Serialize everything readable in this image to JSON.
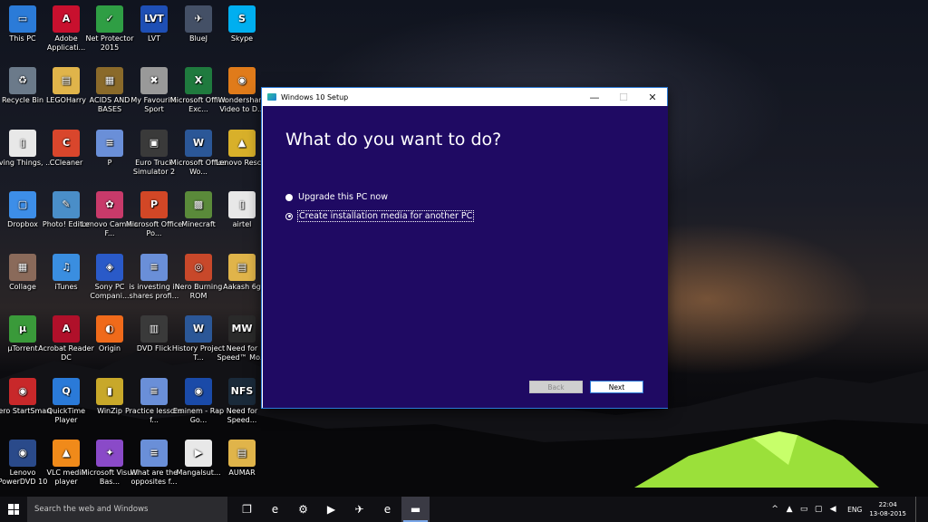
{
  "desktop": {
    "icons": [
      {
        "label": "This PC",
        "glyph": "▭",
        "color": "#2b7bd8"
      },
      {
        "label": "Adobe Applicati...",
        "glyph": "A",
        "color": "#c8102e"
      },
      {
        "label": "Net Protector 2015",
        "glyph": "✓",
        "color": "#2f9e44"
      },
      {
        "label": "LVT",
        "glyph": "LVT",
        "color": "#1e4fb5"
      },
      {
        "label": "BlueJ",
        "glyph": "✈",
        "color": "#445066"
      },
      {
        "label": "Skype",
        "glyph": "S",
        "color": "#00aff0"
      },
      {
        "label": "Recycle Bin",
        "glyph": "♻",
        "color": "#6b7a8a"
      },
      {
        "label": "LEGOHarry",
        "glyph": "▤",
        "color": "#e0b44a"
      },
      {
        "label": "ACIDS AND BASES",
        "glyph": "▦",
        "color": "#8a6a2a"
      },
      {
        "label": "My Favourite Sport",
        "glyph": "✖",
        "color": "#999999"
      },
      {
        "label": "Microsoft Office Exc...",
        "glyph": "X",
        "color": "#1f7a3e"
      },
      {
        "label": "Wondershare Video to D...",
        "glyph": "◉",
        "color": "#e07b1a"
      },
      {
        "label": "Living Things, ...",
        "glyph": "▯",
        "color": "#e8e8e8"
      },
      {
        "label": "CCleaner",
        "glyph": "C",
        "color": "#d9462c"
      },
      {
        "label": "P",
        "glyph": "≡",
        "color": "#6a8fd8"
      },
      {
        "label": "Euro Truck Simulator 2",
        "glyph": "▣",
        "color": "#3a3a3a"
      },
      {
        "label": "Microsoft Office Wo...",
        "glyph": "W",
        "color": "#2b5797"
      },
      {
        "label": "Lenovo Resc...",
        "glyph": "▲",
        "color": "#d8b02a"
      },
      {
        "label": "Dropbox",
        "glyph": "▢",
        "color": "#3d8ee8"
      },
      {
        "label": "Photo! Editor",
        "glyph": "✎",
        "color": "#4a8ec8"
      },
      {
        "label": "Lenovo Camera F...",
        "glyph": "✿",
        "color": "#c83a6a"
      },
      {
        "label": "Microsoft Office Po...",
        "glyph": "P",
        "color": "#d24726"
      },
      {
        "label": "Minecraft",
        "glyph": "▩",
        "color": "#5a8a3a"
      },
      {
        "label": "airtel",
        "glyph": "▯",
        "color": "#e8e8e8"
      },
      {
        "label": "Collage",
        "glyph": "▦",
        "color": "#8a6a5a"
      },
      {
        "label": "iTunes",
        "glyph": "♫",
        "color": "#3a8ee0"
      },
      {
        "label": "Sony PC Compani...",
        "glyph": "◈",
        "color": "#2a5ac8"
      },
      {
        "label": "is investing in shares profi...",
        "glyph": "≡",
        "color": "#6a8fd8"
      },
      {
        "label": "Nero Burning ROM",
        "glyph": "◎",
        "color": "#c8482a"
      },
      {
        "label": "Aakash 6g",
        "glyph": "▤",
        "color": "#e0b44a"
      },
      {
        "label": "µTorrent",
        "glyph": "µ",
        "color": "#3a9a3a"
      },
      {
        "label": "Acrobat Reader DC",
        "glyph": "A",
        "color": "#b0102a"
      },
      {
        "label": "Origin",
        "glyph": "◐",
        "color": "#f06a1a"
      },
      {
        "label": "DVD Flick",
        "glyph": "▥",
        "color": "#3a3a3a"
      },
      {
        "label": "History Project T...",
        "glyph": "W",
        "color": "#2b5797"
      },
      {
        "label": "Need for Speed™ Mo...",
        "glyph": "MW",
        "color": "#2a2a2a"
      },
      {
        "label": "Nero StartSmart",
        "glyph": "◉",
        "color": "#c8282a"
      },
      {
        "label": "QuickTime Player",
        "glyph": "Q",
        "color": "#2a7ad8"
      },
      {
        "label": "WinZip",
        "glyph": "▮",
        "color": "#c8a82a"
      },
      {
        "label": "Practice lessons f...",
        "glyph": "≡",
        "color": "#6a8fd8"
      },
      {
        "label": "Eminem - Rap Go...",
        "glyph": "◉",
        "color": "#1a4aa8"
      },
      {
        "label": "Need for Speed...",
        "glyph": "NFS",
        "color": "#1a2a3a"
      },
      {
        "label": "Lenovo PowerDVD 10",
        "glyph": "◉",
        "color": "#2a4a8a"
      },
      {
        "label": "VLC media player",
        "glyph": "▲",
        "color": "#f08a1a"
      },
      {
        "label": "Microsoft Visual Bas...",
        "glyph": "✦",
        "color": "#8a4ac8"
      },
      {
        "label": "What are the opposites f...",
        "glyph": "≡",
        "color": "#6a8fd8"
      },
      {
        "label": "Mangalsut...",
        "glyph": "▶",
        "color": "#e8e8e8"
      },
      {
        "label": "AUMAR",
        "glyph": "▤",
        "color": "#e0b44a"
      }
    ]
  },
  "setup_window": {
    "title": "Windows 10 Setup",
    "minimize": "—",
    "maximize": "☐",
    "close": "✕",
    "heading": "What do you want to do?",
    "options": [
      {
        "label": "Upgrade this PC now",
        "selected": false
      },
      {
        "label": "Create installation media for another PC",
        "selected": true
      }
    ],
    "back_label": "Back",
    "next_label": "Next"
  },
  "taskbar": {
    "search_placeholder": "Search the web and Windows",
    "items": [
      {
        "name": "task-view",
        "glyph": "❐"
      },
      {
        "name": "edge",
        "glyph": "e"
      },
      {
        "name": "store",
        "glyph": "⚙"
      },
      {
        "name": "media",
        "glyph": "▶"
      },
      {
        "name": "bluej",
        "glyph": "✈"
      },
      {
        "name": "ie",
        "glyph": "e"
      },
      {
        "name": "windows-setup",
        "glyph": "▬"
      }
    ],
    "tray": {
      "chevron": "^",
      "network": "▲",
      "battery": "▭",
      "message": "▢",
      "volume": "◀",
      "language": "ENG",
      "time": "22:04",
      "date": "13-08-2015"
    }
  },
  "colors": {
    "setup_background": "#1f0a63",
    "window_border": "#2b79d6",
    "taskbar": "#101014"
  }
}
